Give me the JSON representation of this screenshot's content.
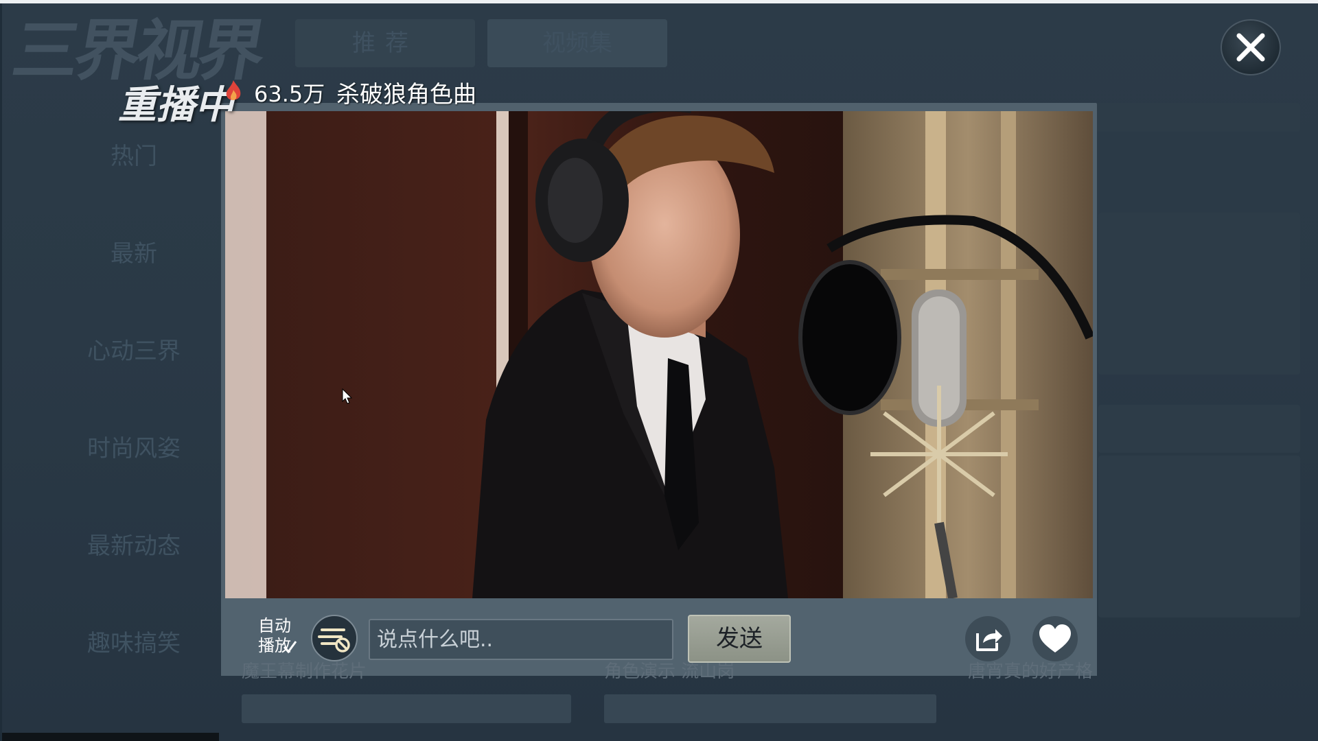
{
  "background": {
    "logo_text": "三界视界",
    "tabs": [
      {
        "label": "推荐"
      },
      {
        "label": "视频集"
      }
    ],
    "sidebar": {
      "items": [
        {
          "label": "热门"
        },
        {
          "label": "最新"
        },
        {
          "label": "心动三界"
        },
        {
          "label": "时尚风姿"
        },
        {
          "label": "最新动态"
        },
        {
          "label": "趣味搞笑"
        }
      ]
    },
    "card_captions": [
      "魔王幕制作花片",
      "角色演示 流山岗",
      "唐宵真的好产格"
    ]
  },
  "player": {
    "status_label": "重播中",
    "view_count": "63.5万",
    "title": "杀破狼角色曲",
    "autoplay_label": "自动播放",
    "autoplay_checked": true,
    "comment_placeholder": "说点什么吧..",
    "send_label": "发送"
  },
  "icons": {
    "close": "close-icon",
    "fire": "fire-icon",
    "danmaku": "danmaku-toggle-icon",
    "share": "share-icon",
    "like": "heart-icon"
  },
  "colors": {
    "panel": "#51616d",
    "background": "#2a3946",
    "send_button": "#9a9f94",
    "text_light": "#ffffff"
  }
}
